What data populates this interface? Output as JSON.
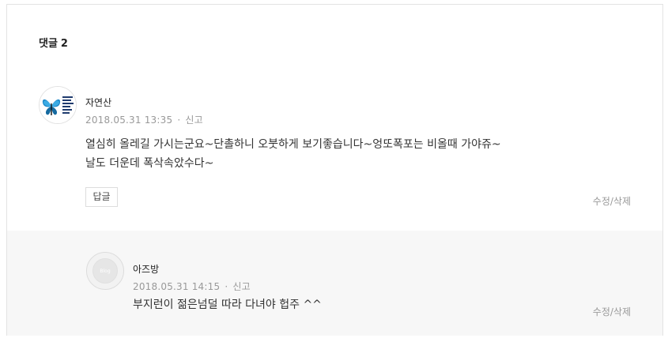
{
  "comments_section": {
    "title": "댓글",
    "count": "2"
  },
  "comments": [
    {
      "author": "자연산",
      "date": "2018.05.31 13:35",
      "separator": "·",
      "report_label": "신고",
      "text_line1": "열심히 올레길 가시는군요~단촐하니 오붓하게 보기좋습니다~엉또폭포는 비올때 가야쥬~",
      "text_line2": "날도 더운데 폭삭속았수다~",
      "reply_label": "답글",
      "edit_label": "수정/삭제"
    },
    {
      "author": "아즈방",
      "date": "2018.05.31 14:15",
      "separator": "·",
      "report_label": "신고",
      "text_line1": "부지런이 젊은넘덜 따라 다녀야 헙주 ^^",
      "edit_label": "수정/삭제",
      "avatar_text": "Blog"
    }
  ],
  "colors": {
    "reply_background": "#f7f7f7",
    "meta_text": "#999999",
    "border": "#e3e3e3"
  }
}
